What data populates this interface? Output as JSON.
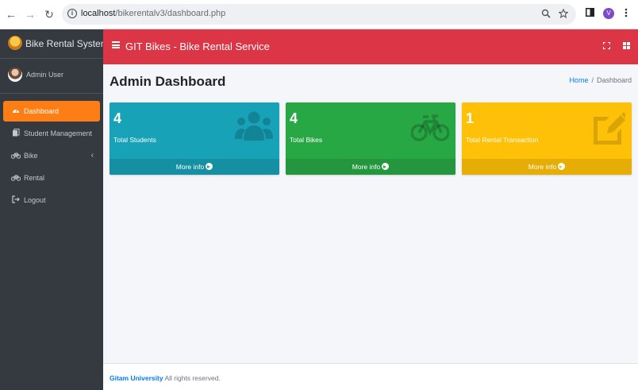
{
  "browser": {
    "url_host": "localhost",
    "url_path": "/bikerentalv3/dashboard.php",
    "profile_initial": "V"
  },
  "sidebar": {
    "brand": "Bike Rental System",
    "user_name": "Admin User",
    "items": [
      {
        "label": "Dashboard",
        "icon": "dashboard-icon",
        "active": true
      },
      {
        "label": "Student Management",
        "icon": "copy-icon",
        "active": false
      },
      {
        "label": "Bike",
        "icon": "bicycle-icon",
        "active": false,
        "has_submenu": true
      },
      {
        "label": "Rental",
        "icon": "bicycle-icon",
        "active": false
      },
      {
        "label": "Logout",
        "icon": "sign-out-icon",
        "active": false
      }
    ]
  },
  "header": {
    "title": "GIT Bikes - Bike Rental Service",
    "accent": "#dc3545"
  },
  "content": {
    "page_title": "Admin Dashboard",
    "breadcrumb": {
      "home": "Home",
      "current": "Dashboard"
    }
  },
  "boxes": [
    {
      "value": "4",
      "label": "Total Students",
      "link": "More info",
      "color": "#17a2b8",
      "icon": "users-icon"
    },
    {
      "value": "4",
      "label": "Total Bikes",
      "link": "More info",
      "color": "#28a745",
      "icon": "bicycle-icon"
    },
    {
      "value": "1",
      "label": "Total Rental Transaction",
      "link": "More info",
      "color": "#ffc107",
      "icon": "edit-icon"
    }
  ],
  "footer": {
    "org": "Gitam University",
    "rights": " All rights reserved."
  }
}
